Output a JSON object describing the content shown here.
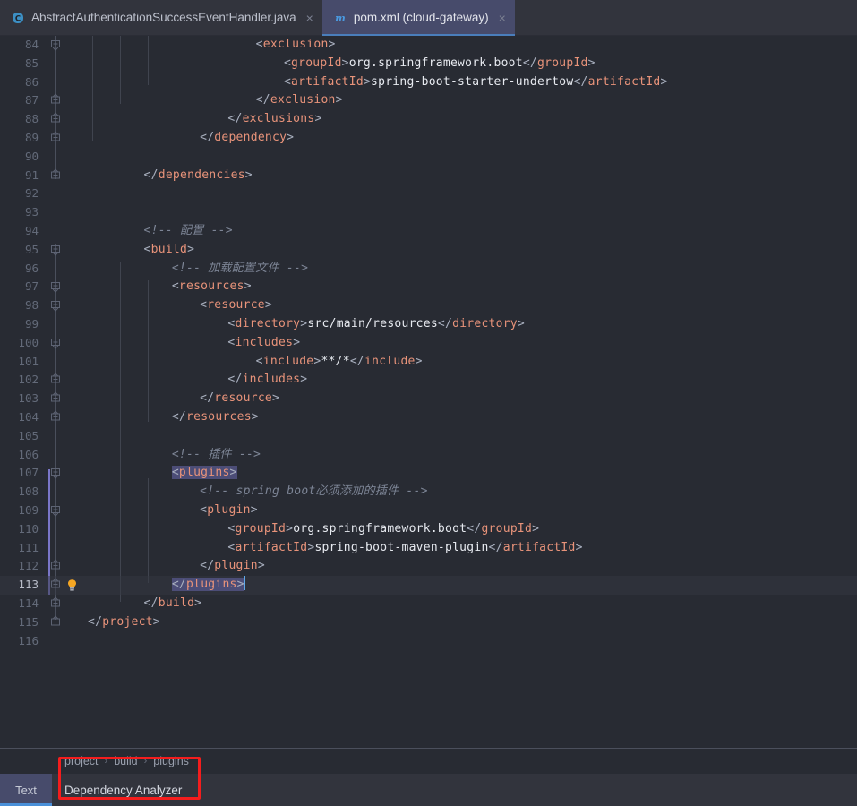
{
  "window": {
    "background": "#282b33",
    "accent": "#4a90d9",
    "annotation_color": "#f41d1d"
  },
  "tabs": [
    {
      "label": "AbstractAuthenticationSuccessEventHandler.java",
      "icon": "java-class-icon",
      "close": "×",
      "active": false
    },
    {
      "label": "pom.xml (cloud-gateway)",
      "icon": "maven-icon",
      "close": "×",
      "active": true
    }
  ],
  "editor": {
    "first_line": 84,
    "current_line": 113,
    "lines": [
      {
        "n": 84,
        "indent": 24,
        "segments": [
          {
            "t": "br",
            "v": "<"
          },
          {
            "t": "tag",
            "v": "exclusion"
          },
          {
            "t": "br",
            "v": ">"
          }
        ]
      },
      {
        "n": 85,
        "indent": 28,
        "segments": [
          {
            "t": "br",
            "v": "<"
          },
          {
            "t": "tag",
            "v": "groupId"
          },
          {
            "t": "br",
            "v": ">"
          },
          {
            "t": "txt",
            "v": "org.springframework.boot"
          },
          {
            "t": "br",
            "v": "</"
          },
          {
            "t": "tag",
            "v": "groupId"
          },
          {
            "t": "br",
            "v": ">"
          }
        ]
      },
      {
        "n": 86,
        "indent": 28,
        "segments": [
          {
            "t": "br",
            "v": "<"
          },
          {
            "t": "tag",
            "v": "artifactId"
          },
          {
            "t": "br",
            "v": ">"
          },
          {
            "t": "txt",
            "v": "spring-boot-starter-undertow"
          },
          {
            "t": "br",
            "v": "</"
          },
          {
            "t": "tag",
            "v": "artifactId"
          },
          {
            "t": "br",
            "v": ">"
          }
        ]
      },
      {
        "n": 87,
        "indent": 24,
        "segments": [
          {
            "t": "br",
            "v": "</"
          },
          {
            "t": "tag",
            "v": "exclusion"
          },
          {
            "t": "br",
            "v": ">"
          }
        ]
      },
      {
        "n": 88,
        "indent": 20,
        "segments": [
          {
            "t": "br",
            "v": "</"
          },
          {
            "t": "tag",
            "v": "exclusions"
          },
          {
            "t": "br",
            "v": ">"
          }
        ]
      },
      {
        "n": 89,
        "indent": 16,
        "segments": [
          {
            "t": "br",
            "v": "</"
          },
          {
            "t": "tag",
            "v": "dependency"
          },
          {
            "t": "br",
            "v": ">"
          }
        ]
      },
      {
        "n": 90,
        "indent": 0,
        "segments": []
      },
      {
        "n": 91,
        "indent": 8,
        "segments": [
          {
            "t": "br",
            "v": "</"
          },
          {
            "t": "tag",
            "v": "dependencies"
          },
          {
            "t": "br",
            "v": ">"
          }
        ]
      },
      {
        "n": 92,
        "indent": 0,
        "segments": []
      },
      {
        "n": 93,
        "indent": 0,
        "segments": []
      },
      {
        "n": 94,
        "indent": 8,
        "segments": [
          {
            "t": "com",
            "v": "<!-- 配置 -->"
          }
        ]
      },
      {
        "n": 95,
        "indent": 8,
        "segments": [
          {
            "t": "br",
            "v": "<"
          },
          {
            "t": "tag",
            "v": "build"
          },
          {
            "t": "br",
            "v": ">"
          }
        ]
      },
      {
        "n": 96,
        "indent": 12,
        "segments": [
          {
            "t": "com",
            "v": "<!-- 加载配置文件 -->"
          }
        ]
      },
      {
        "n": 97,
        "indent": 12,
        "segments": [
          {
            "t": "br",
            "v": "<"
          },
          {
            "t": "tag",
            "v": "resources"
          },
          {
            "t": "br",
            "v": ">"
          }
        ]
      },
      {
        "n": 98,
        "indent": 16,
        "segments": [
          {
            "t": "br",
            "v": "<"
          },
          {
            "t": "tag",
            "v": "resource"
          },
          {
            "t": "br",
            "v": ">"
          }
        ]
      },
      {
        "n": 99,
        "indent": 20,
        "segments": [
          {
            "t": "br",
            "v": "<"
          },
          {
            "t": "tag",
            "v": "directory"
          },
          {
            "t": "br",
            "v": ">"
          },
          {
            "t": "txt",
            "v": "src/main/resources"
          },
          {
            "t": "br",
            "v": "</"
          },
          {
            "t": "tag",
            "v": "directory"
          },
          {
            "t": "br",
            "v": ">"
          }
        ]
      },
      {
        "n": 100,
        "indent": 20,
        "segments": [
          {
            "t": "br",
            "v": "<"
          },
          {
            "t": "tag",
            "v": "includes"
          },
          {
            "t": "br",
            "v": ">"
          }
        ]
      },
      {
        "n": 101,
        "indent": 24,
        "segments": [
          {
            "t": "br",
            "v": "<"
          },
          {
            "t": "tag",
            "v": "include"
          },
          {
            "t": "br",
            "v": ">"
          },
          {
            "t": "txt",
            "v": "**/*"
          },
          {
            "t": "br",
            "v": "</"
          },
          {
            "t": "tag",
            "v": "include"
          },
          {
            "t": "br",
            "v": ">"
          }
        ]
      },
      {
        "n": 102,
        "indent": 20,
        "segments": [
          {
            "t": "br",
            "v": "</"
          },
          {
            "t": "tag",
            "v": "includes"
          },
          {
            "t": "br",
            "v": ">"
          }
        ]
      },
      {
        "n": 103,
        "indent": 16,
        "segments": [
          {
            "t": "br",
            "v": "</"
          },
          {
            "t": "tag",
            "v": "resource"
          },
          {
            "t": "br",
            "v": ">"
          }
        ]
      },
      {
        "n": 104,
        "indent": 12,
        "segments": [
          {
            "t": "br",
            "v": "</"
          },
          {
            "t": "tag",
            "v": "resources"
          },
          {
            "t": "br",
            "v": ">"
          }
        ]
      },
      {
        "n": 105,
        "indent": 0,
        "segments": []
      },
      {
        "n": 106,
        "indent": 12,
        "segments": [
          {
            "t": "com",
            "v": "<!-- 插件 -->"
          }
        ]
      },
      {
        "n": 107,
        "indent": 12,
        "selected": true,
        "segments": [
          {
            "t": "br",
            "v": "<"
          },
          {
            "t": "tag",
            "v": "plugins"
          },
          {
            "t": "br",
            "v": ">"
          }
        ]
      },
      {
        "n": 108,
        "indent": 16,
        "segments": [
          {
            "t": "com",
            "v": "<!-- spring boot必须添加的插件 -->"
          }
        ]
      },
      {
        "n": 109,
        "indent": 16,
        "segments": [
          {
            "t": "br",
            "v": "<"
          },
          {
            "t": "tag",
            "v": "plugin"
          },
          {
            "t": "br",
            "v": ">"
          }
        ]
      },
      {
        "n": 110,
        "indent": 20,
        "segments": [
          {
            "t": "br",
            "v": "<"
          },
          {
            "t": "tag",
            "v": "groupId"
          },
          {
            "t": "br",
            "v": ">"
          },
          {
            "t": "txt",
            "v": "org.springframework.boot"
          },
          {
            "t": "br",
            "v": "</"
          },
          {
            "t": "tag",
            "v": "groupId"
          },
          {
            "t": "br",
            "v": ">"
          }
        ]
      },
      {
        "n": 111,
        "indent": 20,
        "segments": [
          {
            "t": "br",
            "v": "<"
          },
          {
            "t": "tag",
            "v": "artifactId"
          },
          {
            "t": "br",
            "v": ">"
          },
          {
            "t": "txt",
            "v": "spring-boot-maven-plugin"
          },
          {
            "t": "br",
            "v": "</"
          },
          {
            "t": "tag",
            "v": "artifactId"
          },
          {
            "t": "br",
            "v": ">"
          }
        ]
      },
      {
        "n": 112,
        "indent": 16,
        "segments": [
          {
            "t": "br",
            "v": "</"
          },
          {
            "t": "tag",
            "v": "plugin"
          },
          {
            "t": "br",
            "v": ">"
          }
        ]
      },
      {
        "n": 113,
        "indent": 12,
        "selected": true,
        "caret": true,
        "bulb": true,
        "segments": [
          {
            "t": "br",
            "v": "</"
          },
          {
            "t": "tag",
            "v": "plugins"
          },
          {
            "t": "br",
            "v": ">"
          }
        ]
      },
      {
        "n": 114,
        "indent": 8,
        "segments": [
          {
            "t": "br",
            "v": "</"
          },
          {
            "t": "tag",
            "v": "build"
          },
          {
            "t": "br",
            "v": ">"
          }
        ]
      },
      {
        "n": 115,
        "indent": 0,
        "segments": [
          {
            "t": "br",
            "v": "</"
          },
          {
            "t": "tag",
            "v": "project"
          },
          {
            "t": "br",
            "v": ">"
          }
        ]
      },
      {
        "n": 116,
        "indent": 0,
        "segments": []
      }
    ],
    "fold_markers": {
      "expanded": [
        84,
        95,
        97,
        98,
        100,
        107,
        109
      ],
      "collapsed_end": [
        87,
        88,
        89,
        91,
        102,
        103,
        104,
        112,
        113,
        114,
        115
      ]
    }
  },
  "breadcrumb": {
    "items": [
      "project",
      "build",
      "plugins"
    ],
    "separator": "›"
  },
  "statusbar": {
    "view_tabs": [
      {
        "label": "Text",
        "active": true
      }
    ],
    "dependency_analyzer": "Dependency Analyzer"
  }
}
